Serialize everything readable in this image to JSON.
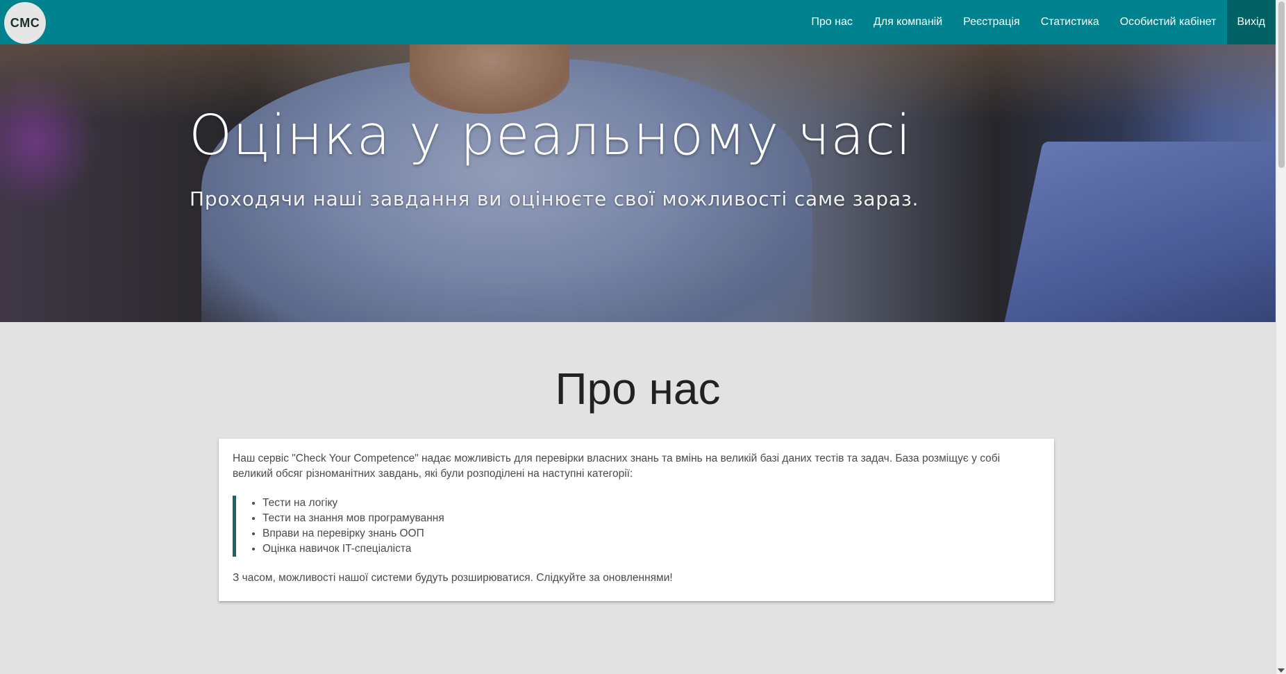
{
  "navbar": {
    "logo_text": "CMC",
    "items": [
      {
        "label": "Про нас"
      },
      {
        "label": "Для компаній"
      },
      {
        "label": "Реєстрація"
      },
      {
        "label": "Статистика"
      },
      {
        "label": "Особистий кабінет"
      },
      {
        "label": "Вихід"
      }
    ],
    "active_item": "Вихід"
  },
  "hero": {
    "title": "Оцінка у реальному часі",
    "subtitle": "Проходячи наші завдання ви оцінюєте свої можливості саме зараз."
  },
  "about": {
    "title": "Про нас",
    "intro": "Наш сервіс \"Check Your Competence\" надає можливість для перевірки власних знань та вмінь на великій базі даних тестів та задач. База розміщує у собі великий обсяг різноманітних завдань, які були розподілені на наступні категорії:",
    "categories": [
      "Тести на логіку",
      "Тести на знання мов програмування",
      "Вправи на перевірку знань ООП",
      "Оцінка навичок IT-спеціаліста"
    ],
    "outro": "З часом, можливості нашої системи будуть розширюватися. Слідкуйте за оновленнями!"
  },
  "colors": {
    "navbar": "#00838f",
    "navbar_active": "#006064",
    "page_background": "#e2e2e2",
    "quote_border": "#1f6363"
  }
}
